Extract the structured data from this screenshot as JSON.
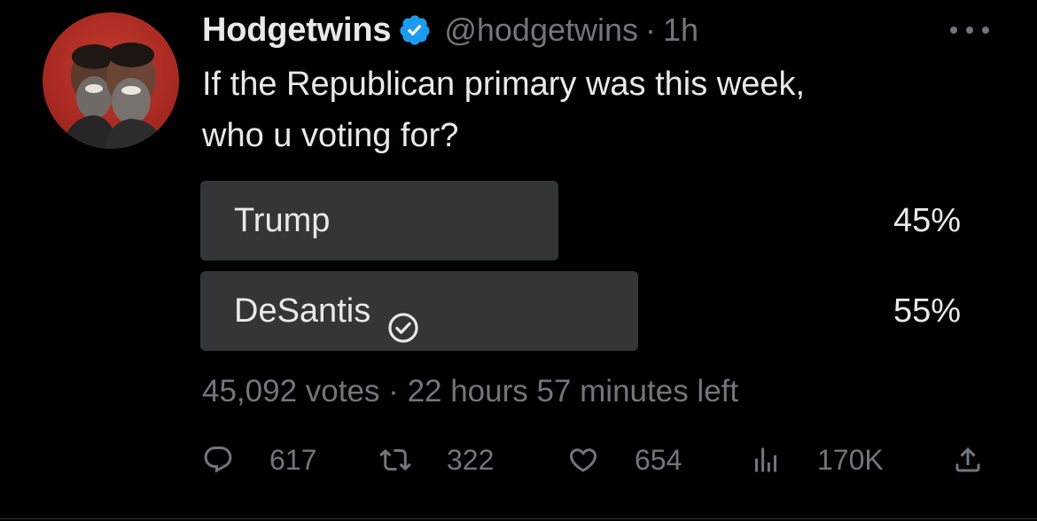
{
  "tweet": {
    "display_name": "Hodgetwins",
    "handle": "@hodgetwins",
    "separator": "·",
    "time": "1h",
    "text_line1": "If the Republican primary was this week,",
    "text_line2": "who u voting for?"
  },
  "poll": {
    "options": [
      {
        "label": "Trump",
        "percent_text": "45%",
        "percent": 0.45,
        "selected": false
      },
      {
        "label": "DeSantis",
        "percent_text": "55%",
        "percent": 0.55,
        "selected": true
      }
    ],
    "votes": "45,092 votes",
    "separator": "·",
    "time_left": "22 hours 57 minutes left"
  },
  "actions": {
    "reply_count": "617",
    "retweet_count": "322",
    "like_count": "654",
    "views_count": "170K"
  },
  "icons": {
    "verified": "verified-badge-icon",
    "more": "more-options-icon",
    "selected_option": "check-circle-icon",
    "reply": "reply-icon",
    "retweet": "retweet-icon",
    "like": "heart-icon",
    "views": "views-chart-icon",
    "share": "share-icon"
  },
  "colors": {
    "background": "#000000",
    "text": "#e7e9ea",
    "secondary_text": "#71767b",
    "poll_bar": "#333639",
    "verified_blue": "#1d9bf0",
    "avatar_bg": "#b0302a"
  }
}
